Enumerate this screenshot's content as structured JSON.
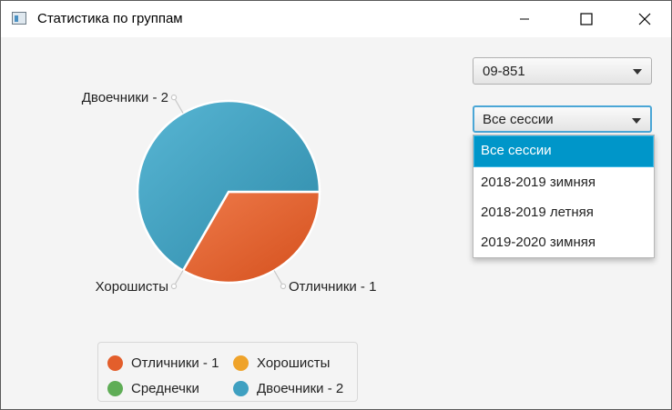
{
  "window": {
    "title": "Статистика по группам",
    "icon": "app-window-icon",
    "controls": {
      "minimize": "minimize-icon",
      "maximize": "maximize-icon",
      "close": "close-icon"
    }
  },
  "group_select": {
    "value": "09-851"
  },
  "session_select": {
    "value": "Все сессии",
    "options": [
      "Все сессии",
      "2018-2019 зимняя",
      "2018-2019 летняя",
      "2019-2020 зимняя"
    ],
    "selected_index": 0
  },
  "colors": {
    "red": "#e35e2b",
    "orange": "#efa32a",
    "green": "#5fad56",
    "blue": "#3fa0c1",
    "accent": "#0096c9"
  },
  "chart_data": {
    "type": "pie",
    "slices": [
      {
        "name": "Отличники",
        "value": 1,
        "color": "#e35e2b",
        "label": "Отличники - 1"
      },
      {
        "name": "Хорошисты",
        "value": 0,
        "color": "#efa32a",
        "label": "Хорошисты"
      },
      {
        "name": "Среднечки",
        "value": 0,
        "color": "#5fad56",
        "label": "Среднечки"
      },
      {
        "name": "Двоечники",
        "value": 2,
        "color": "#3fa0c1",
        "label": "Двоечники - 2"
      }
    ],
    "legend": [
      {
        "label": "Отличники - 1",
        "color": "#e35e2b"
      },
      {
        "label": "Хорошисты",
        "color": "#efa32a"
      },
      {
        "label": "Среднечки",
        "color": "#5fad56"
      },
      {
        "label": "Двоечники - 2",
        "color": "#3fa0c1"
      }
    ],
    "legend_position": "bottom"
  }
}
